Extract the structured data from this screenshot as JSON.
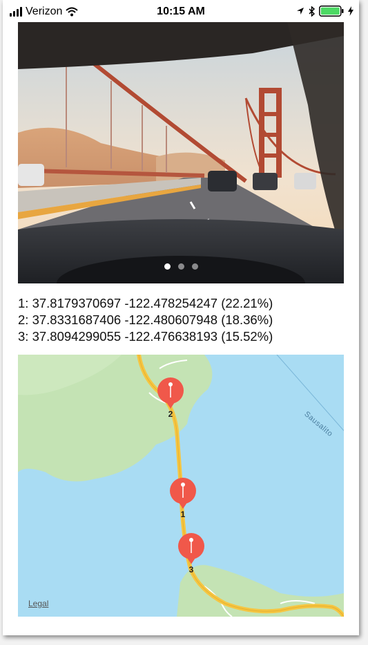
{
  "status_bar": {
    "carrier": "Verizon",
    "time": "10:15 AM",
    "signal_icon": "signal-bars-icon",
    "wifi_icon": "wifi-icon",
    "location_icon": "location-arrow-icon",
    "bluetooth_icon": "bluetooth-icon",
    "battery_icon": "battery-icon",
    "charging_icon": "charging-bolt-icon",
    "battery_color": "#4cd964"
  },
  "carousel": {
    "page_count": 3,
    "active_page": 1
  },
  "predictions": [
    {
      "text": "1: 37.8179370697 -122.478254247 (22.21%)"
    },
    {
      "text": "2: 37.8331687406 -122.480607948 (18.36%)"
    },
    {
      "text": "3: 37.8094299055 -122.476638193 (15.52%)"
    }
  ],
  "map": {
    "place_label": "Sausalito",
    "legal_label": "Legal",
    "pin_color": "#f0584a",
    "water_color": "#a9dcf3",
    "land_color": "#c4e3b4",
    "road_color": "#f5c643",
    "pins": [
      {
        "label": "1"
      },
      {
        "label": "2"
      },
      {
        "label": "3"
      }
    ]
  }
}
